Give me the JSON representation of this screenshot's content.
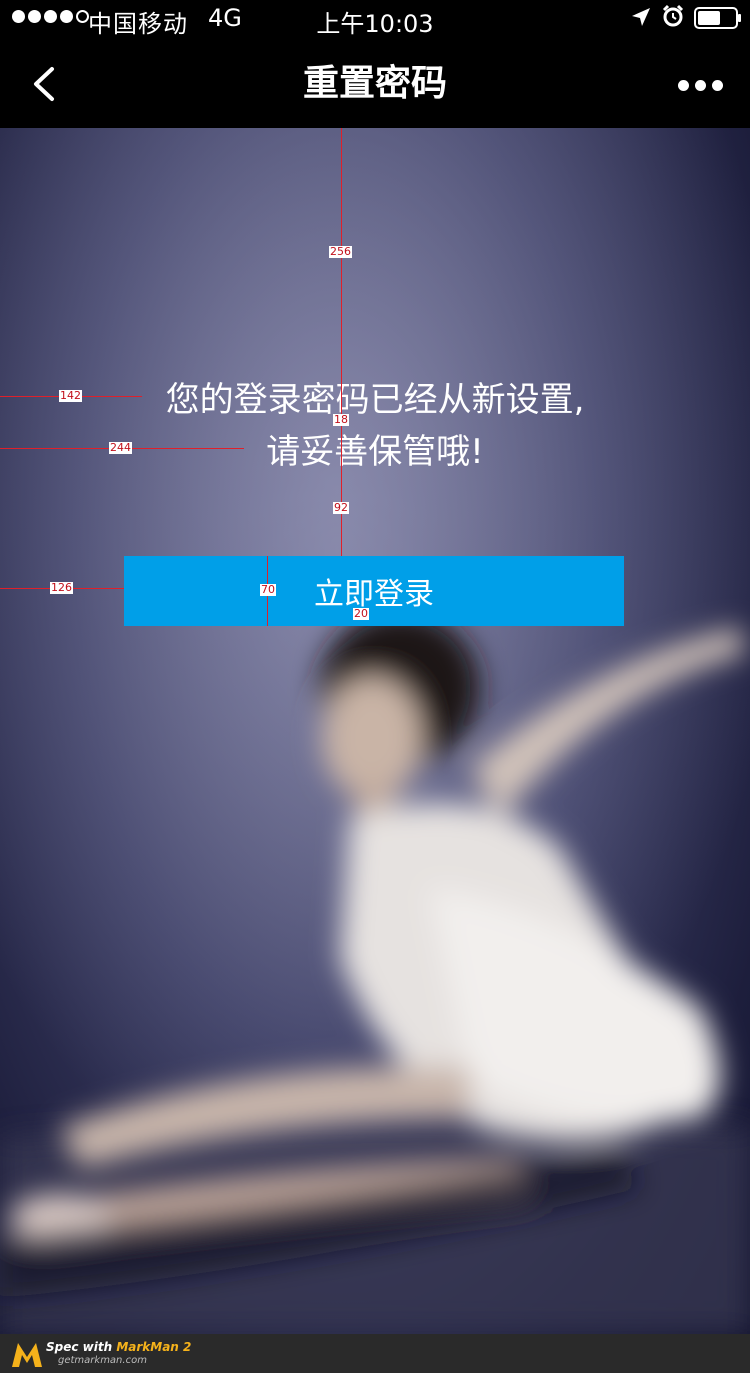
{
  "status_bar": {
    "carrier": "中国移动",
    "network": "4G",
    "time": "上午10:03"
  },
  "nav": {
    "title": "重置密码"
  },
  "message": {
    "line1": "您的登录密码已经从新设置,",
    "line2": "请妥善保管哦!"
  },
  "login_button": {
    "label": "立即登录"
  },
  "annotations": {
    "top_gap": "256",
    "left_line1": "142",
    "line_gap": "18",
    "left_line2": "244",
    "text_button_gap": "92",
    "button_left": "126",
    "button_height": "70",
    "text_offset": "20"
  },
  "footer": {
    "spec_prefix": "Spec with ",
    "brand": "MarkMan 2",
    "url": "getmarkman.com"
  },
  "colors": {
    "button": "#009fe8",
    "bar": "#000000",
    "annotation": "#e0202a"
  },
  "icons": [
    "back-chevron-icon",
    "more-icon",
    "location-icon",
    "alarm-icon",
    "battery-icon",
    "markman-logo"
  ]
}
